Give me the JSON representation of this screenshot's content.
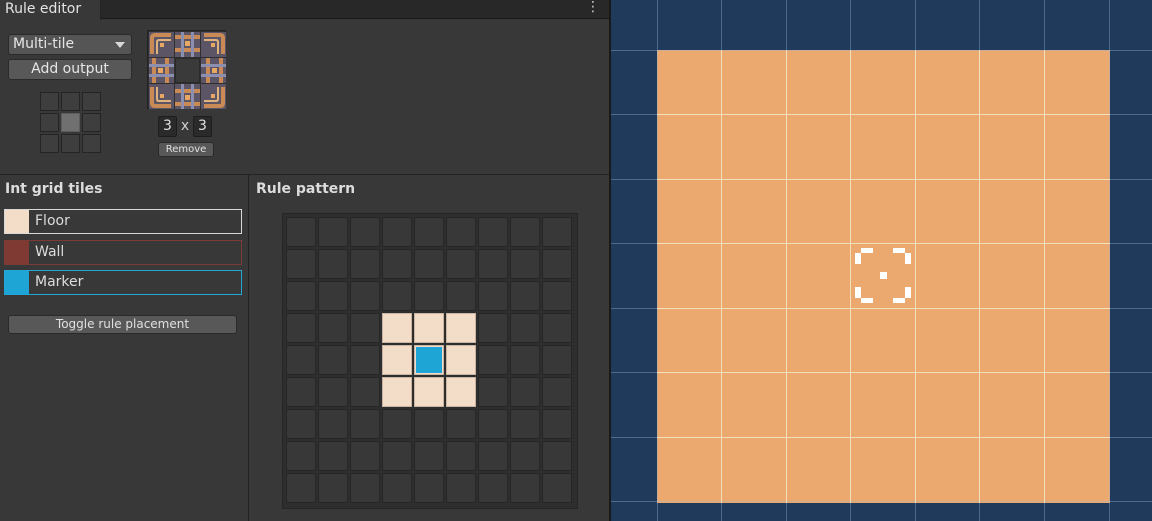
{
  "window": {
    "tab_title": "Rule editor",
    "menu_glyph": "⋮"
  },
  "output": {
    "mode_value": "Multi-tile",
    "add_output_label": "Add output",
    "width": "3",
    "height": "3",
    "dimension_separator": "x",
    "remove_label": "Remove"
  },
  "int_grid": {
    "title": "Int grid tiles",
    "tiles": [
      {
        "name": "Floor",
        "color": "#f3dcc8"
      },
      {
        "name": "Wall",
        "color": "#7f3a34"
      },
      {
        "name": "Marker",
        "color": "#1ea5d6"
      }
    ],
    "toggle_label": "Toggle rule placement"
  },
  "rule_pattern": {
    "title": "Rule pattern",
    "size": 9,
    "cells": [
      [
        0,
        0,
        0,
        0,
        0,
        0,
        0,
        0,
        0
      ],
      [
        0,
        0,
        0,
        0,
        0,
        0,
        0,
        0,
        0
      ],
      [
        0,
        0,
        0,
        0,
        0,
        0,
        0,
        0,
        0
      ],
      [
        0,
        0,
        0,
        1,
        1,
        1,
        0,
        0,
        0
      ],
      [
        0,
        0,
        0,
        1,
        3,
        1,
        0,
        0,
        0
      ],
      [
        0,
        0,
        0,
        1,
        1,
        1,
        0,
        0,
        0
      ],
      [
        0,
        0,
        0,
        0,
        0,
        0,
        0,
        0,
        0
      ],
      [
        0,
        0,
        0,
        0,
        0,
        0,
        0,
        0,
        0
      ],
      [
        0,
        0,
        0,
        0,
        0,
        0,
        0,
        0,
        0
      ]
    ]
  },
  "scene": {
    "background_color": "#203a5c",
    "floor_color": "#eba86f",
    "cursor_icon": "selection-brackets-icon"
  }
}
